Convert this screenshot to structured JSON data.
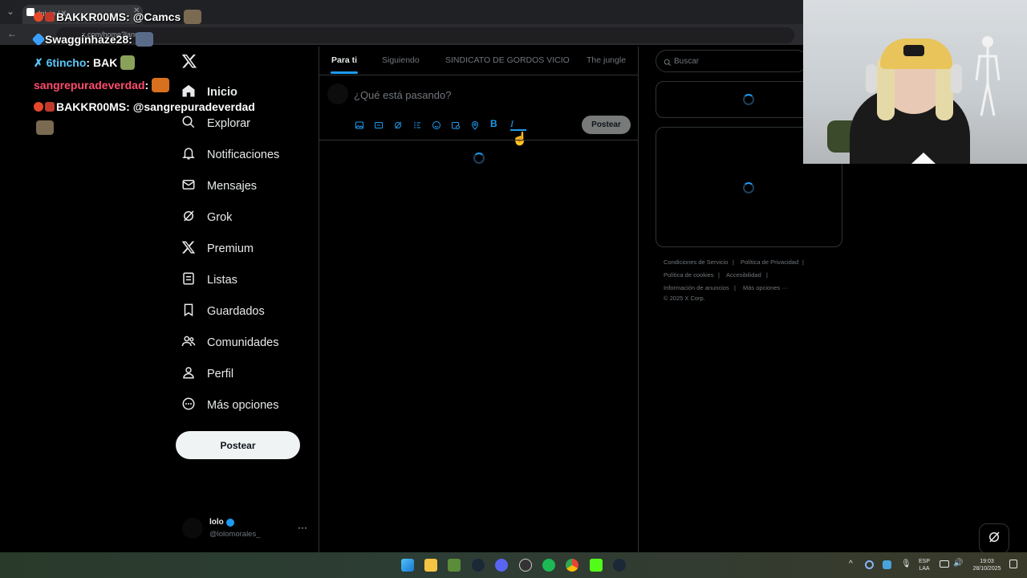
{
  "browser": {
    "tab_title": "Inicio / X",
    "address": "x.com/home?lang"
  },
  "chat": [
    {
      "user": "BAKKR00MS",
      "message": "@Camcs",
      "color": "#ffffff"
    },
    {
      "user": "Swagginhaze28",
      "message": "",
      "color": "#ffffff"
    },
    {
      "user": "6tincho",
      "message": "BAK",
      "color": "#5ac8fa"
    },
    {
      "user": "sangrepuradeverdad",
      "message": "",
      "color": "#ff4d6d"
    },
    {
      "user": "BAKKR00MS",
      "message": "@sangrepuradeverdad",
      "color": "#ffffff"
    }
  ],
  "nav": {
    "items": [
      {
        "label": "Inicio",
        "icon": "home-icon"
      },
      {
        "label": "Explorar",
        "icon": "search-icon"
      },
      {
        "label": "Notificaciones",
        "icon": "bell-icon"
      },
      {
        "label": "Mensajes",
        "icon": "mail-icon"
      },
      {
        "label": "Grok",
        "icon": "grok-icon"
      },
      {
        "label": "Premium",
        "icon": "x-logo-icon"
      },
      {
        "label": "Listas",
        "icon": "list-icon"
      },
      {
        "label": "Guardados",
        "icon": "bookmark-icon"
      },
      {
        "label": "Comunidades",
        "icon": "communities-icon"
      },
      {
        "label": "Perfil",
        "icon": "person-icon"
      },
      {
        "label": "Más opciones",
        "icon": "more-circle-icon"
      }
    ],
    "post_button": "Postear"
  },
  "account": {
    "name": "lolo",
    "handle": "@lolomorales_"
  },
  "feed": {
    "tabs": [
      "Para ti",
      "Siguiendo",
      "SINDICATO DE GORDOS VICIO",
      "The jungle"
    ],
    "active_tab": "Para ti",
    "compose_placeholder": "¿Qué está pasando?",
    "compose_button": "Postear",
    "tools": [
      "image-icon",
      "gif-icon",
      "grok-icon",
      "poll-icon",
      "emoji-icon",
      "schedule-icon",
      "location-icon",
      "bold-icon",
      "italic-icon"
    ]
  },
  "sidebar": {
    "search_placeholder": "Buscar",
    "footer_links": [
      "Condiciones de Servicio",
      "Política de Privacidad",
      "Política de cookies",
      "Accesibilidad",
      "Información de anuncios",
      "Más opciones ···"
    ],
    "copyright": "© 2025 X Corp."
  },
  "taskbar": {
    "lang_top": "ESP",
    "lang_bottom": "LAA",
    "time": "19:03",
    "date": "28/10/2025"
  },
  "colors": {
    "accent": "#1d9bf0",
    "background": "#000000",
    "border": "#2f3336",
    "text_secondary": "#71767b"
  }
}
